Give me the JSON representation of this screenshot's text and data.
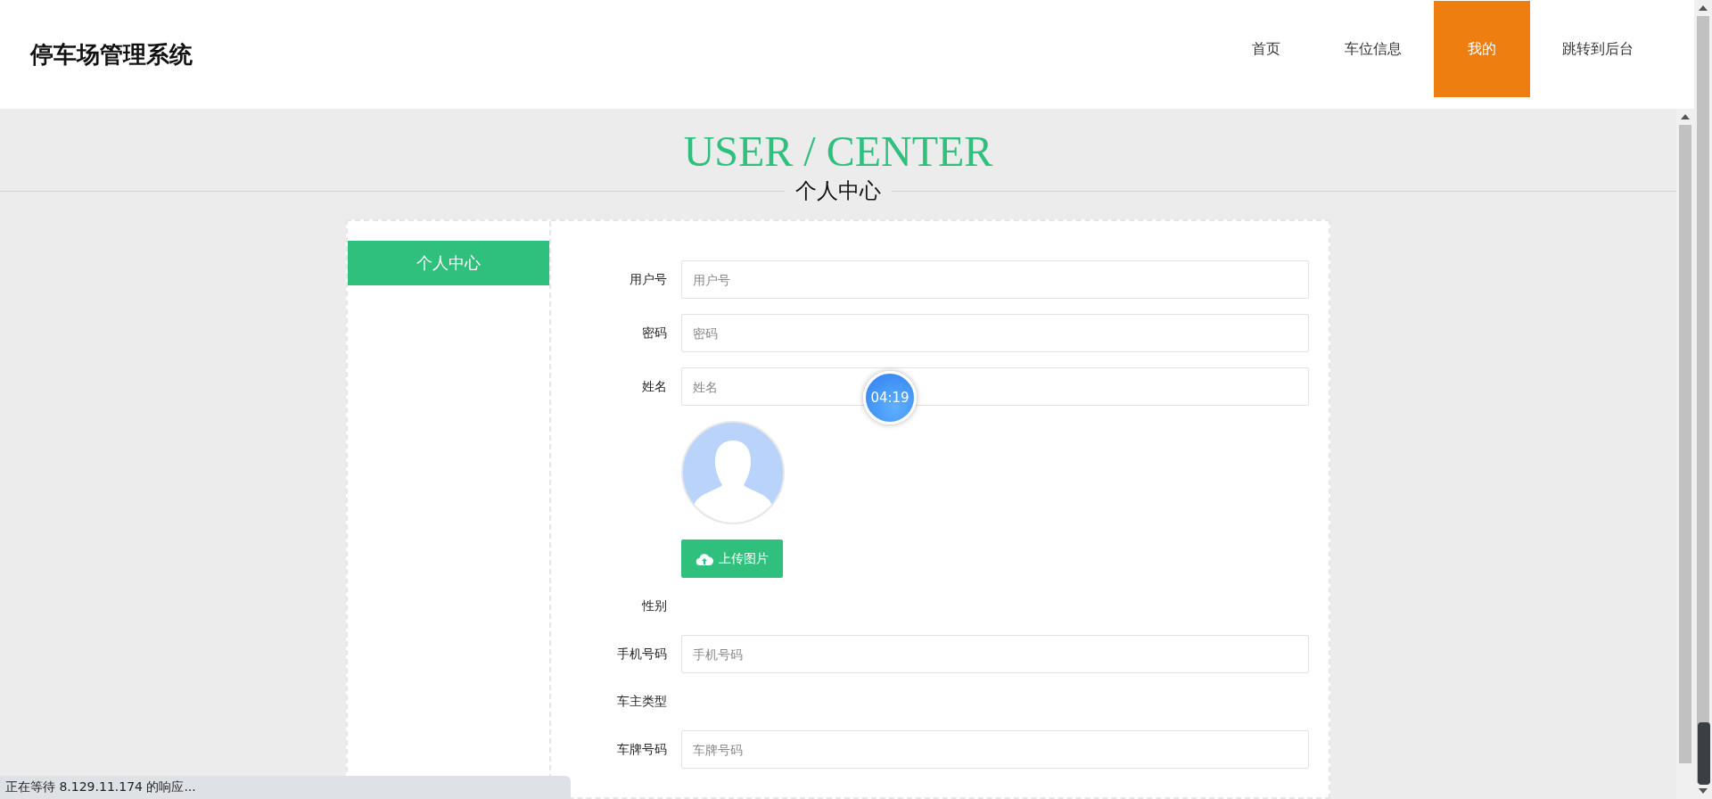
{
  "header": {
    "title": "停车场管理系统",
    "nav": [
      {
        "label": "首页",
        "selected": false
      },
      {
        "label": "车位信息",
        "selected": false
      },
      {
        "label": "我的",
        "selected": true
      },
      {
        "label": "跳转到后台",
        "selected": false
      }
    ]
  },
  "banner": {
    "title": "USER / CENTER",
    "subtitle": "个人中心"
  },
  "sidebar": {
    "items": [
      {
        "label": "个人中心",
        "selected": true
      }
    ]
  },
  "form": {
    "fields": [
      {
        "kind": "input",
        "label": "用户号",
        "placeholder": "用户号"
      },
      {
        "kind": "input",
        "label": "密码",
        "placeholder": "密码"
      },
      {
        "kind": "input",
        "label": "姓名",
        "placeholder": "姓名"
      },
      {
        "kind": "avatar"
      },
      {
        "kind": "upload",
        "label": "上传图片"
      },
      {
        "kind": "blank",
        "label": "性别"
      },
      {
        "kind": "input",
        "label": "手机号码",
        "placeholder": "手机号码"
      },
      {
        "kind": "blank",
        "label": "车主类型"
      },
      {
        "kind": "input",
        "label": "车牌号码",
        "placeholder": "车牌号码"
      }
    ]
  },
  "timer_badge": "04:19",
  "status_bar": "正在等待 8.129.11.174 的响应..."
}
